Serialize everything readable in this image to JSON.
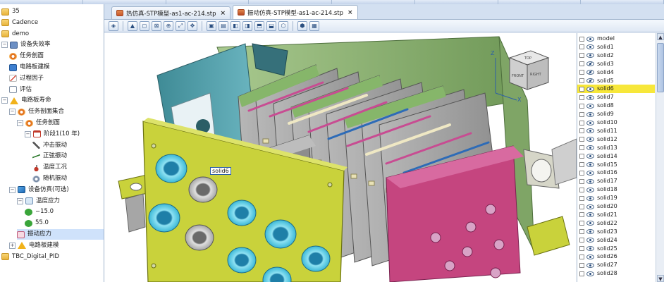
{
  "tree": {
    "items": [
      {
        "label": "35",
        "icon": "folder-icon",
        "expander": ""
      },
      {
        "label": "Cadence",
        "icon": "folder-icon",
        "expander": ""
      },
      {
        "label": "demo",
        "icon": "folder-icon",
        "expander": ""
      },
      {
        "label": "设备失效率",
        "icon": "building-icon",
        "expander": "−"
      },
      {
        "label": "任务剖面",
        "icon": "gear-icon",
        "expander": ""
      },
      {
        "label": "电路板建模",
        "icon": "board-icon",
        "expander": ""
      },
      {
        "label": "过程因子",
        "icon": "chart-icon",
        "expander": ""
      },
      {
        "label": "评估",
        "icon": "document-icon",
        "expander": ""
      },
      {
        "label": "电路板寿命",
        "icon": "warning-icon",
        "expander": "−"
      },
      {
        "label": "任务剖面集合",
        "icon": "gear-icon",
        "expander": "−"
      },
      {
        "label": "任务剖面",
        "icon": "gear-icon",
        "expander": "−"
      },
      {
        "label": "阶段1(10 年)",
        "icon": "calendar-icon",
        "expander": "−"
      },
      {
        "label": "冲击振动",
        "icon": "hammer-icon",
        "expander": ""
      },
      {
        "label": "正弦振动",
        "icon": "sine-wave-icon",
        "expander": ""
      },
      {
        "label": "温度工况",
        "icon": "temperature-icon",
        "expander": ""
      },
      {
        "label": "随机振动",
        "icon": "random-vibration-icon",
        "expander": ""
      },
      {
        "label": "设备仿真(可选)",
        "icon": "cube-icon",
        "expander": "−"
      },
      {
        "label": "温度应力",
        "icon": "thermometer-icon",
        "expander": "−"
      },
      {
        "label": "−15.0",
        "icon": "check-icon",
        "expander": ""
      },
      {
        "label": "55.0",
        "icon": "check-icon",
        "expander": ""
      },
      {
        "label": "振动应力",
        "icon": "vibration-icon",
        "expander": ""
      },
      {
        "label": "电路板建模",
        "icon": "warning-icon",
        "expander": "+"
      },
      {
        "label": "TBC_Digital_PID",
        "icon": "folder-icon",
        "expander": ""
      }
    ],
    "selected_index": 20
  },
  "tabs": [
    {
      "label": "热仿真-STP模型-as1-ac-214.stp",
      "icon": "thermal-tab-icon",
      "close": "×"
    },
    {
      "label": "振动仿真-STP模型-as1-ac-214.stp",
      "icon": "vibration-tab-icon",
      "close": "×"
    }
  ],
  "active_tab": 1,
  "toolbar_icons": [
    "cube-view-icon",
    "sep",
    "color-icon",
    "zoom-region-icon",
    "select-box-icon",
    "zoom-in-icon",
    "zoom-fit-icon",
    "pan-icon",
    "sep",
    "view-front-icon",
    "view-back-icon",
    "view-left-icon",
    "view-right-icon",
    "view-top-icon",
    "view-bottom-icon",
    "view-iso-icon",
    "sep",
    "wireframe-icon",
    "shaded-icon"
  ],
  "viewport": {
    "tag_label": "solid6",
    "axis_z": "Z",
    "axis_x": "X",
    "navcube_top": "TOP",
    "navcube_front": "FRONT",
    "navcube_right": "RIGHT"
  },
  "object_panel": {
    "items": [
      {
        "label": "model",
        "state": "visible"
      },
      {
        "label": "solid1",
        "state": "visible"
      },
      {
        "label": "solid2",
        "state": "visible"
      },
      {
        "label": "solid3",
        "state": "hidden"
      },
      {
        "label": "solid4",
        "state": "hidden"
      },
      {
        "label": "solid5",
        "state": "hidden"
      },
      {
        "label": "solid6",
        "state": "selected"
      },
      {
        "label": "solid7",
        "state": "visible"
      },
      {
        "label": "solid8",
        "state": "visible"
      },
      {
        "label": "solid9",
        "state": "visible"
      },
      {
        "label": "solid10",
        "state": "visible"
      },
      {
        "label": "solid11",
        "state": "visible"
      },
      {
        "label": "solid12",
        "state": "visible"
      },
      {
        "label": "solid13",
        "state": "visible"
      },
      {
        "label": "solid14",
        "state": "visible"
      },
      {
        "label": "solid15",
        "state": "visible"
      },
      {
        "label": "solid16",
        "state": "visible"
      },
      {
        "label": "solid17",
        "state": "visible"
      },
      {
        "label": "solid18",
        "state": "visible"
      },
      {
        "label": "solid19",
        "state": "visible"
      },
      {
        "label": "solid20",
        "state": "visible"
      },
      {
        "label": "solid21",
        "state": "visible"
      },
      {
        "label": "solid22",
        "state": "visible"
      },
      {
        "label": "solid23",
        "state": "visible"
      },
      {
        "label": "solid24",
        "state": "visible"
      },
      {
        "label": "solid25",
        "state": "visible"
      },
      {
        "label": "solid26",
        "state": "visible"
      },
      {
        "label": "solid27",
        "state": "visible"
      },
      {
        "label": "solid28",
        "state": "visible"
      }
    ],
    "scroll_up": "▲",
    "scroll_down": "▼"
  },
  "colors": {
    "selection_highlight": "#f7e73a",
    "front_panel": "#c9d23b",
    "side_panel": "#c5457f",
    "boards": "#9b9b9b",
    "chassis_top": "#8fb27a",
    "cylinders": "#3bb8d6"
  }
}
